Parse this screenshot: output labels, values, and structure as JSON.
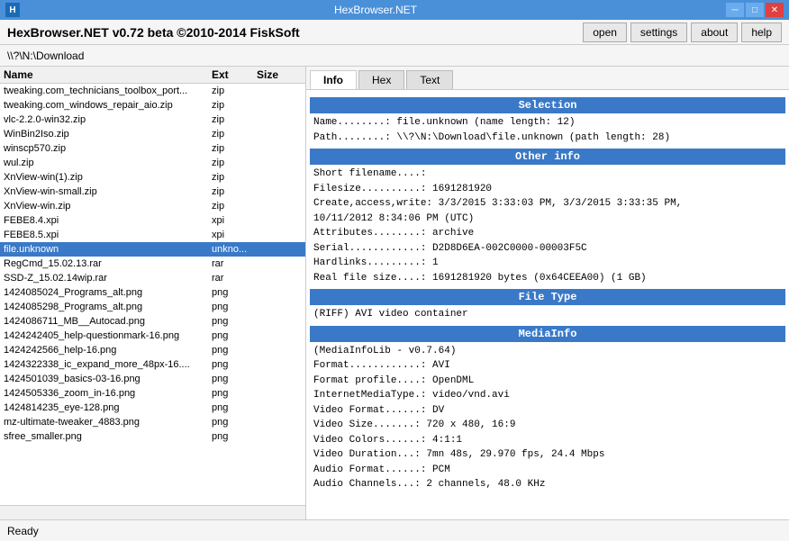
{
  "titleBar": {
    "title": "HexBrowser.NET",
    "icon": "H",
    "minimize": "─",
    "maximize": "□",
    "close": "✕"
  },
  "menuBar": {
    "appTitle": "HexBrowser.NET v0.72 beta  ©2010-2014 FiskSoft",
    "buttons": [
      "open",
      "settings",
      "about",
      "help"
    ]
  },
  "pathBar": {
    "path": "\\\\?\\N:\\Download"
  },
  "tabs": {
    "items": [
      "Info",
      "Hex",
      "Text"
    ],
    "active": 0
  },
  "fileList": {
    "headers": {
      "name": "Name",
      "ext": "Ext",
      "size": "Size"
    },
    "files": [
      {
        "name": "tweaking.com_technicians_toolbox_port...",
        "ext": "zip",
        "size": ""
      },
      {
        "name": "tweaking.com_windows_repair_aio.zip",
        "ext": "zip",
        "size": ""
      },
      {
        "name": "vlc-2.2.0-win32.zip",
        "ext": "zip",
        "size": ""
      },
      {
        "name": "WinBin2Iso.zip",
        "ext": "zip",
        "size": ""
      },
      {
        "name": "winscp570.zip",
        "ext": "zip",
        "size": ""
      },
      {
        "name": "wul.zip",
        "ext": "zip",
        "size": ""
      },
      {
        "name": "XnView-win(1).zip",
        "ext": "zip",
        "size": ""
      },
      {
        "name": "XnView-win-small.zip",
        "ext": "zip",
        "size": ""
      },
      {
        "name": "XnView-win.zip",
        "ext": "zip",
        "size": ""
      },
      {
        "name": "FEBE8.4.xpi",
        "ext": "xpi",
        "size": ""
      },
      {
        "name": "FEBE8.5.xpi",
        "ext": "xpi",
        "size": ""
      },
      {
        "name": "file.unknown",
        "ext": "unkno...",
        "size": "",
        "selected": true
      },
      {
        "name": "RegCmd_15.02.13.rar",
        "ext": "rar",
        "size": ""
      },
      {
        "name": "SSD-Z_15.02.14wip.rar",
        "ext": "rar",
        "size": ""
      },
      {
        "name": "1424085024_Programs_alt.png",
        "ext": "png",
        "size": ""
      },
      {
        "name": "1424085298_Programs_alt.png",
        "ext": "png",
        "size": ""
      },
      {
        "name": "1424086711_MB__Autocad.png",
        "ext": "png",
        "size": ""
      },
      {
        "name": "1424242405_help-questionmark-16.png",
        "ext": "png",
        "size": ""
      },
      {
        "name": "1424242566_help-16.png",
        "ext": "png",
        "size": ""
      },
      {
        "name": "1424322338_ic_expand_more_48px-16....",
        "ext": "png",
        "size": ""
      },
      {
        "name": "1424501039_basics-03-16.png",
        "ext": "png",
        "size": ""
      },
      {
        "name": "1424505336_zoom_in-16.png",
        "ext": "png",
        "size": ""
      },
      {
        "name": "1424814235_eye-128.png",
        "ext": "png",
        "size": ""
      },
      {
        "name": "mz-ultimate-tweaker_4883.png",
        "ext": "png",
        "size": ""
      },
      {
        "name": "sfree_smaller.png",
        "ext": "png",
        "size": ""
      }
    ]
  },
  "infoPanel": {
    "sections": [
      {
        "title": "Selection",
        "lines": [
          "Name........: file.unknown (name length: 12)",
          "Path........: \\\\?\\N:\\Download\\file.unknown (path length: 28)"
        ]
      },
      {
        "title": "Other info",
        "lines": [
          "Short filename....:",
          "Filesize..........: 1691281920",
          "Create,access,write: 3/3/2015 3:33:03 PM, 3/3/2015 3:33:35 PM,",
          "10/11/2012 8:34:06 PM (UTC)",
          "Attributes........: archive",
          "Serial............: D2D8D6EA-002C0000-00003F5C",
          "Hardlinks.........: 1",
          "Real file size....: 1691281920 bytes (0x64CEEA00) (1 GB)"
        ]
      },
      {
        "title": "File Type",
        "lines": [
          "(RIFF) AVI video container"
        ]
      },
      {
        "title": "MediaInfo",
        "lines": [
          "(MediaInfoLib - v0.7.64)",
          "Format............: AVI",
          "Format profile....: OpenDML",
          "InternetMediaType.: video/vnd.avi",
          "Video Format......: DV",
          "Video Size.......: 720 x 480, 16:9",
          "Video Colors......: 4:1:1",
          "Video Duration...: 7mn 48s, 29.970 fps, 24.4 Mbps",
          "Audio Format......: PCM",
          "Audio Channels...: 2 channels, 48.0 KHz"
        ]
      }
    ]
  },
  "statusBar": {
    "text": "Ready"
  }
}
